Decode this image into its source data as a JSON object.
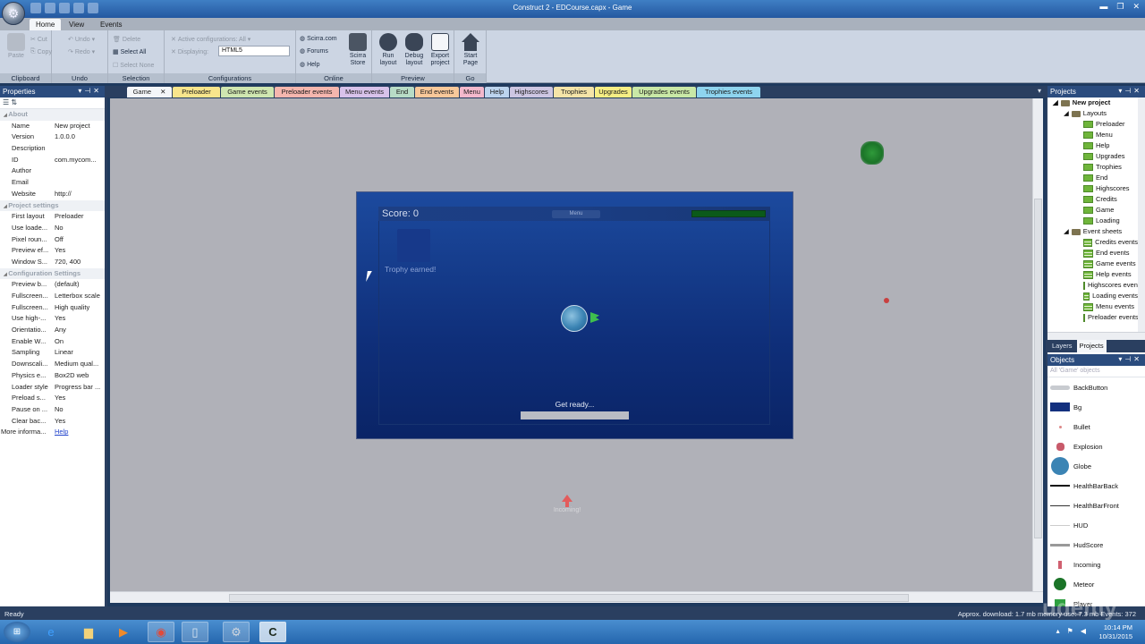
{
  "window": {
    "title": "Construct 2 - EDCourse.capx - Game",
    "controls": [
      "minimize",
      "restore",
      "close"
    ]
  },
  "ribbon_tabs": [
    {
      "label": "Home",
      "active": true
    },
    {
      "label": "View"
    },
    {
      "label": "Events"
    }
  ],
  "ribbon": {
    "clipboard": {
      "label": "Clipboard",
      "paste": "Paste",
      "cut": "Cut",
      "copy": "Copy"
    },
    "undo": {
      "label": "Undo",
      "undo": "Undo",
      "redo": "Redo"
    },
    "selection": {
      "label": "Selection",
      "delete": "Delete",
      "select_all": "Select All",
      "select_none": "Select None"
    },
    "configurations": {
      "label": "Configurations",
      "active": "Active configurations: All",
      "displaying": "Displaying:",
      "displaying_value": "HTML5"
    },
    "online": {
      "label": "Online",
      "scirra": "Scirra.com",
      "forums": "Forums",
      "help": "Help",
      "store": "Scirra Store"
    },
    "preview": {
      "label": "Preview",
      "run": "Run layout",
      "debug": "Debug layout",
      "export": "Export project"
    },
    "go": {
      "label": "Go",
      "start": "Start Page"
    }
  },
  "doc_tabs": [
    {
      "label": "Game",
      "active": true,
      "closable": true,
      "color": "#f4f6f9"
    },
    {
      "label": "Preloader",
      "color": "#f8e58c"
    },
    {
      "label": "Game events",
      "color": "#cfe6b0"
    },
    {
      "label": "Preloader events",
      "color": "#f5b6ae"
    },
    {
      "label": "Menu events",
      "color": "#d8c2ea"
    },
    {
      "label": "End",
      "color": "#b8dcc6"
    },
    {
      "label": "End events",
      "color": "#f8c89a"
    },
    {
      "label": "Menu",
      "color": "#f3b8cc"
    },
    {
      "label": "Help",
      "color": "#bcd4ee"
    },
    {
      "label": "Highscores",
      "color": "#cdc6e2"
    },
    {
      "label": "Trophies",
      "color": "#f4e4a8"
    },
    {
      "label": "Upgrades",
      "color": "#f6ee84"
    },
    {
      "label": "Upgrades events",
      "color": "#c9e8a6"
    },
    {
      "label": "Trophies events",
      "color": "#8ed4ee"
    }
  ],
  "properties": {
    "title": "Properties",
    "sections": [
      {
        "name": "About",
        "rows": [
          [
            "Name",
            "New project"
          ],
          [
            "Version",
            "1.0.0.0"
          ],
          [
            "Description",
            ""
          ],
          [
            "ID",
            "com.mycom..."
          ],
          [
            "Author",
            ""
          ],
          [
            "Email",
            ""
          ],
          [
            "Website",
            "http://"
          ]
        ]
      },
      {
        "name": "Project settings",
        "rows": [
          [
            "First layout",
            "Preloader"
          ],
          [
            "Use loade...",
            "No"
          ],
          [
            "Pixel roun...",
            "Off"
          ],
          [
            "Preview ef...",
            "Yes"
          ],
          [
            "Window S...",
            "720, 400"
          ]
        ]
      },
      {
        "name": "Configuration Settings",
        "rows": [
          [
            "Preview b...",
            "(default)"
          ],
          [
            "Fullscreen...",
            "Letterbox scale"
          ],
          [
            "Fullscreen...",
            "High quality"
          ],
          [
            "Use high-...",
            "Yes"
          ],
          [
            "Orientatio...",
            "Any"
          ],
          [
            "Enable W...",
            "On"
          ],
          [
            "Sampling",
            "Linear"
          ],
          [
            "Downscali...",
            "Medium qual..."
          ],
          [
            "Physics e...",
            "Box2D web"
          ],
          [
            "Loader style",
            "Progress bar ..."
          ],
          [
            "Preload s...",
            "Yes"
          ],
          [
            "Pause on ...",
            "No"
          ],
          [
            "Clear bac...",
            "Yes"
          ]
        ]
      }
    ],
    "more_info_label": "More informa...",
    "more_info_link": "Help"
  },
  "game": {
    "score": "Score: 0",
    "menu": "Menu",
    "trophy": "Trophy earned!",
    "get_ready": "Get ready...",
    "incoming": "Incoming!"
  },
  "projects": {
    "title": "Projects",
    "root": "New project",
    "layouts_folder": "Layouts",
    "layouts": [
      "Preloader",
      "Menu",
      "Help",
      "Upgrades",
      "Trophies",
      "End",
      "Highscores",
      "Credits",
      "Game",
      "Loading"
    ],
    "events_folder": "Event sheets",
    "event_sheets": [
      "Credits events",
      "End events",
      "Game events",
      "Help events",
      "Highscores events",
      "Loading events",
      "Menu events",
      "Preloader events"
    ],
    "tabs": [
      "Layers",
      "Projects"
    ]
  },
  "objects": {
    "title": "Objects",
    "filter_placeholder": "All 'Game' objects",
    "items": [
      "BackButton",
      "Bg",
      "Bullet",
      "Explosion",
      "Globe",
      "HealthBarBack",
      "HealthBarFront",
      "HUD",
      "HudScore",
      "Incoming",
      "Meteor",
      "Player"
    ]
  },
  "status": {
    "left": "Ready",
    "right": "Approx. download: 1.7 mb  memory use: 7.3 mb  Events: 372"
  },
  "taskbar": {
    "time": "10:14 PM",
    "date": "10/31/2015"
  },
  "watermark": "udemy"
}
